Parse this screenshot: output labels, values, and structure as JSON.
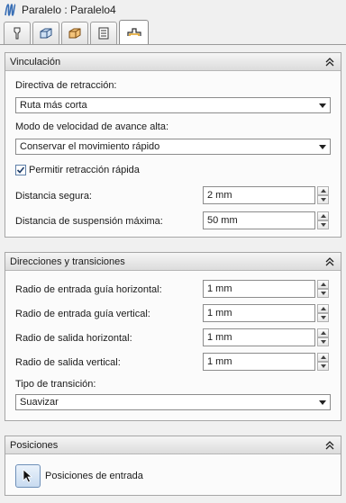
{
  "window": {
    "title": "Paralelo : Paralelo4"
  },
  "tabs": [
    {
      "icon": "tool-icon"
    },
    {
      "icon": "stock-box-icon"
    },
    {
      "icon": "geometry-box-icon"
    },
    {
      "icon": "heights-icon"
    },
    {
      "icon": "linking-icon",
      "active": true
    }
  ],
  "sections": {
    "linking": {
      "title": "Vinculación",
      "retract_label": "Directiva de retracción:",
      "retract_value": "Ruta más corta",
      "feed_label": "Modo de velocidad de avance alta:",
      "feed_value": "Conservar el movimiento rápido",
      "quick_retract_label": "Permitir retracción rápida",
      "quick_retract_checked": true,
      "safe_distance_label": "Distancia segura:",
      "safe_distance_value": "2 mm",
      "max_stay_down_label": "Distancia de suspensión máxima:",
      "max_stay_down_value": "50 mm"
    },
    "leads": {
      "title": "Direcciones y transiciones",
      "lead_in_h_label": "Radio de entrada guía horizontal:",
      "lead_in_h_value": "1 mm",
      "lead_in_v_label": "Radio de entrada guía vertical:",
      "lead_in_v_value": "1 mm",
      "lead_out_h_label": "Radio de salida horizontal:",
      "lead_out_h_value": "1 mm",
      "lead_out_v_label": "Radio de salida vertical:",
      "lead_out_v_value": "1 mm",
      "transition_label": "Tipo de transición:",
      "transition_value": "Suavizar"
    },
    "positions": {
      "title": "Posiciones",
      "entry_label": "Posiciones de entrada"
    }
  }
}
